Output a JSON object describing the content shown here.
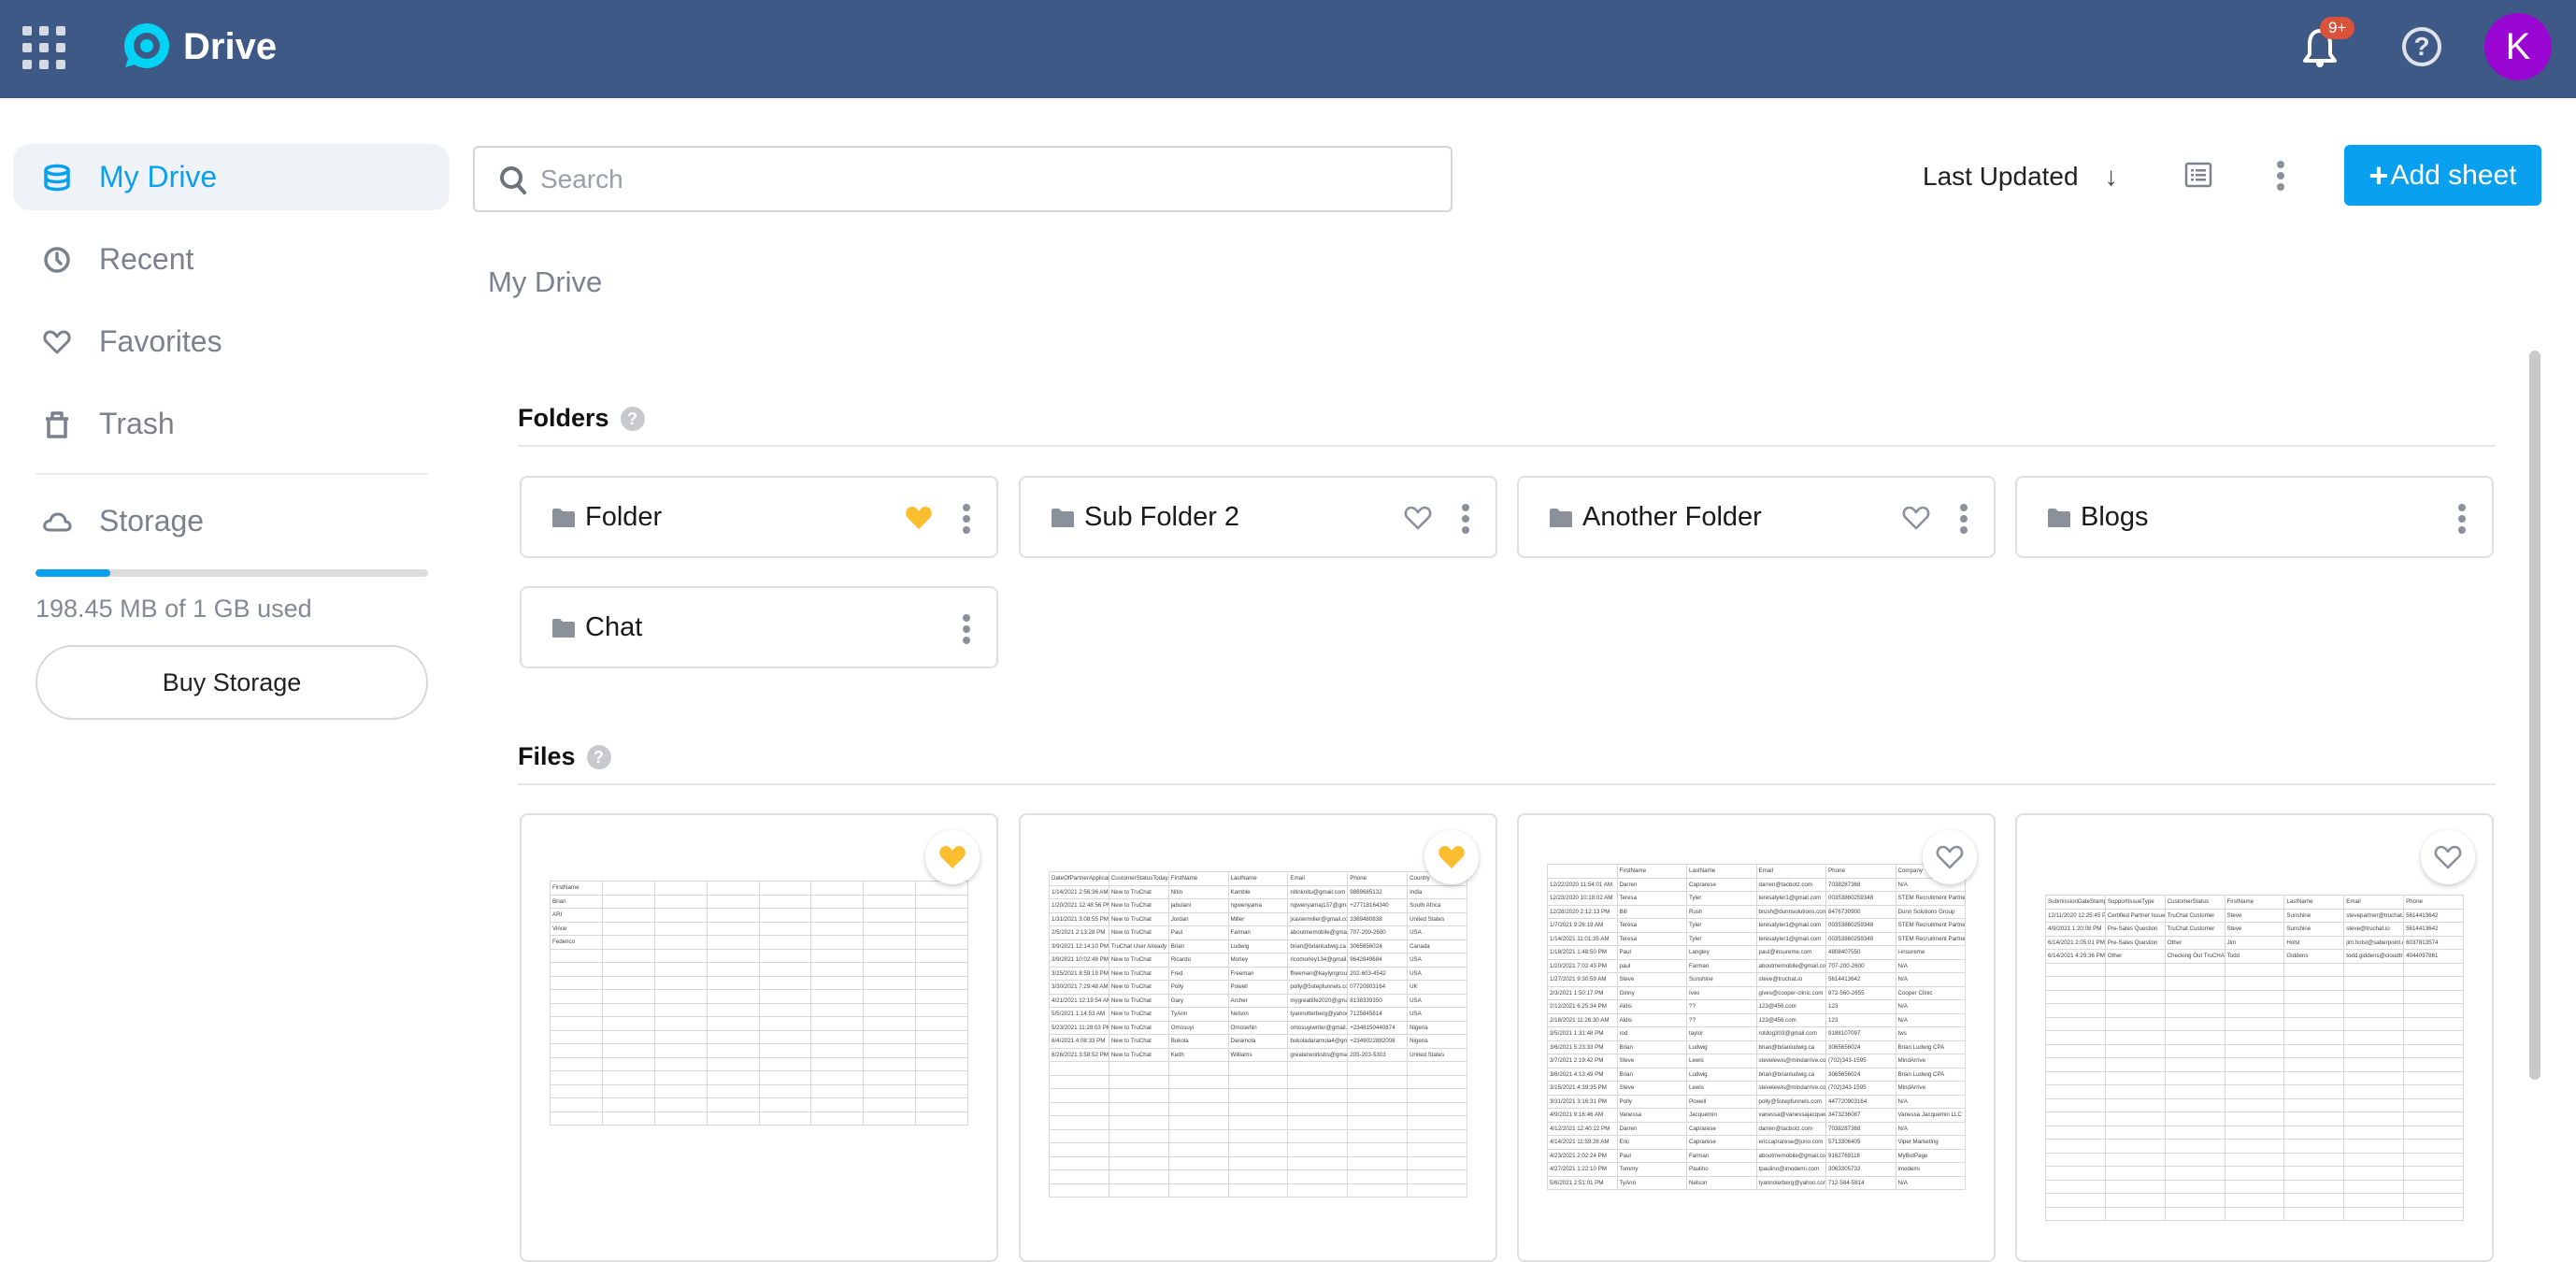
{
  "header": {
    "app_name": "Drive",
    "notification_count": "9+",
    "avatar_initial": "K",
    "colors": {
      "header_bg": "#3f5986",
      "logo": "#00d4f5",
      "badge": "#d9533a",
      "avatar": "#9a06d2"
    }
  },
  "sidebar": {
    "items": [
      {
        "label": "My Drive",
        "icon": "database-icon",
        "active": true
      },
      {
        "label": "Recent",
        "icon": "clock-icon",
        "active": false
      },
      {
        "label": "Favorites",
        "icon": "heart-icon",
        "active": false
      },
      {
        "label": "Trash",
        "icon": "trash-icon",
        "active": false
      }
    ],
    "storage": {
      "label": "Storage",
      "icon": "cloud-icon",
      "used_fraction": 0.19,
      "used_text": "198.45 MB of 1 GB used",
      "buy_label": "Buy Storage"
    },
    "accent": "#0aa0f0"
  },
  "toolbar": {
    "search_placeholder": "Search",
    "search_value": "",
    "sort_label": "Last Updated",
    "sort_direction_icon": "arrow-down-icon",
    "add_label": "Add sheet",
    "add_icon": "+"
  },
  "main": {
    "title": "My Drive",
    "folders_heading": "Folders",
    "files_heading": "Files",
    "help_glyph": "?",
    "folders": [
      {
        "name": "Folder",
        "favorite": true,
        "show_heart": true
      },
      {
        "name": "Sub Folder 2",
        "favorite": false,
        "show_heart": true
      },
      {
        "name": "Another Folder",
        "favorite": false,
        "show_heart": true
      },
      {
        "name": "Blogs",
        "favorite": false,
        "show_heart": false
      },
      {
        "name": "Chat",
        "favorite": false,
        "show_heart": false
      }
    ],
    "files": [
      {
        "favorite": true,
        "preview": {
          "cols": 8,
          "rows": [
            [
              "FirstName"
            ],
            [
              "Brian"
            ],
            [
              "ARI"
            ],
            [
              "Vince"
            ],
            [
              "Federico"
            ]
          ],
          "empty_rows": 13
        }
      },
      {
        "favorite": true,
        "preview": {
          "cols": 7,
          "rows": [
            [
              "DateOfPartnerApplication",
              "CustomerStatusToday",
              "FirstName",
              "LastName",
              "Email",
              "Phone",
              "Country"
            ],
            [
              "1/14/2021 2:56:36 AM",
              "New to TruChat",
              "Nitin",
              "Kamble",
              "nitinknitu@gmail.com",
              "9869685132",
              "India"
            ],
            [
              "1/20/2021 12:48:56 PM",
              "New to TruChat",
              "jabulani",
              "ngwenyama",
              "ngwenyamaj137@gmail.com",
              "+27718164340",
              "South Africa"
            ],
            [
              "1/31/2021 3:08:55 PM",
              "New to TruChat",
              "Jordan",
              "Miller",
              "jxaviermiller@gmail.com",
              "3369480838",
              "United States"
            ],
            [
              "2/5/2021 2:13:28 PM",
              "New to TruChat",
              "Paul",
              "Farman",
              "aboutmemobile@gmail.com",
              "707-200-2600",
              "USA"
            ],
            [
              "3/9/2021 12:14:10 PM",
              "TruChat User Already",
              "Brian",
              "Ludwig",
              "brian@brianludwig.ca",
              "3065656024",
              "Canada"
            ],
            [
              "3/9/2021 10:02:48 PM",
              "New to TruChat",
              "Ricardo",
              "Morley",
              "ricomorley134@gmail.com",
              "9642849684",
              "USA"
            ],
            [
              "3/25/2021 8:59:19 PM",
              "New to TruChat",
              "Fred",
              "Freeman",
              "ffreeman@kaylyngroup.com",
              "202-603-4542",
              "USA"
            ],
            [
              "3/30/2021 7:29:48 AM",
              "New to TruChat",
              "Polly",
              "Powell",
              "polly@5stepfunnels.com",
              "07720903164",
              "UK"
            ],
            [
              "4/21/2021 12:19:54 AM",
              "New to TruChat",
              "Gary",
              "Archer",
              "mygreatlife2020@gmail.com",
              "8138339350",
              "USA"
            ],
            [
              "5/5/2021 1:14:53 AM",
              "New to TruChat",
              "TyAnn",
              "Nelson",
              "tyannotterberg@yahoo.com",
              "7125845814",
              "USA"
            ],
            [
              "5/23/2021 11:28:03 PM",
              "New to TruChat",
              "Omosuyi",
              "Omosehin",
              "omosuyiwriter@gmail.com",
              "+2348150440874",
              "Nigeria"
            ],
            [
              "6/4/2021 4:08:33 PM",
              "New to TruChat",
              "Bukola",
              "Daramola",
              "bukoladaramola4@gmail.com",
              "+2349022882008",
              "Nigeria"
            ],
            [
              "6/26/2021 3:58:52 PM",
              "New to TruChat",
              "Keith",
              "Williams",
              "greaterworksbs@gmail.com",
              "205-203-5303",
              "United States"
            ]
          ],
          "empty_rows": 10
        }
      },
      {
        "favorite": false,
        "preview": {
          "cols": 6,
          "rows": [
            [
              "",
              "FirstName",
              "LastName",
              "Email",
              "Phone",
              "Company"
            ],
            [
              "12/22/2020 11:54:01 AM",
              "Darren",
              "Caprarese",
              "darren@tacbotz.com",
              "7038287368",
              "N/A"
            ],
            [
              "12/23/2020 10:18:02 AM",
              "Teresa",
              "Tyler",
              "teresatyler1@gmail.com",
              "00353860259348",
              "STEM Recruitment Partners"
            ],
            [
              "12/28/2020 2:12:13 PM",
              "Bill",
              "Rush",
              "brush@dunnsolutions.com",
              "8476730900",
              "Dunn Solutions Group"
            ],
            [
              "1/7/2021 9:26:19 AM",
              "Teresa",
              "Tyler",
              "teresatyler1@gmail.com",
              "00353860259348",
              "STEM Recruitment Partners"
            ],
            [
              "1/14/2021 11:01:35 AM",
              "Teresa",
              "Tyler",
              "teresatyler1@gmail.com",
              "00353860259348",
              "STEM Recruitment Partners"
            ],
            [
              "1/18/2021 1:48:50 PM",
              "Paul",
              "Langley",
              "paul@insureme.com",
              "4808407550",
              "i-insureme"
            ],
            [
              "1/20/2021 7:02:43 PM",
              "paul",
              "Farman",
              "aboutmemobile@gmail.com",
              "707-200-2600",
              "N/A"
            ],
            [
              "1/27/2021 9:30:59 AM",
              "Steve",
              "Sunshine",
              "steve@truchat.io",
              "5614413642",
              "N/A"
            ],
            [
              "2/3/2021 1:50:17 PM",
              "Ginny",
              "Ives",
              "gives@cooper-clinic.com",
              "972-560-2655",
              "Cooper Clinic"
            ],
            [
              "2/12/2021 6:25:34 PM",
              "Aldis",
              "??",
              "123@456.com",
              "123",
              "N/A"
            ],
            [
              "2/18/2021 11:26:30 AM",
              "Aldis",
              "??",
              "123@456.com",
              "123",
              "N/A"
            ],
            [
              "3/5/2021 1:31:48 PM",
              "rod",
              "taylor",
              "rotdog303@gmail.com",
              "9188107097",
              "tws"
            ],
            [
              "3/6/2021 5:23:33 PM",
              "Brian",
              "Ludwig",
              "brian@brianludwig.ca",
              "3065656024",
              "Brian Ludwig CPA"
            ],
            [
              "3/7/2021 2:19:42 PM",
              "Steve",
              "Lewis",
              "stevelewis@mindarrive.com",
              "(702)343-1595",
              "MindArrive"
            ],
            [
              "3/8/2021 4:13:49 PM",
              "Brian",
              "Ludwig",
              "brian@brianludwig.ca",
              "3065656024",
              "Brian Ludwig CPA"
            ],
            [
              "3/15/2021 4:39:35 PM",
              "Steve",
              "Lewis",
              "stevelewis@mindarrive.com",
              "(702)343-1595",
              "MindArrive"
            ],
            [
              "3/31/2021 3:16:31 PM",
              "Polly",
              "Powell",
              "polly@5stepfunnels.com",
              "447720903164",
              "N/A"
            ],
            [
              "4/9/2021 9:16:46 AM",
              "Vanessa",
              "Jacquemin",
              "vanessa@vanessajacquemin.com",
              "3473236087",
              "Vanessa Jacquemin LLC"
            ],
            [
              "4/12/2021 12:40:22 PM",
              "Darren",
              "Caprarese",
              "darren@tacbotz.com",
              "7038287368",
              "N/A"
            ],
            [
              "4/14/2021 11:59:26 AM",
              "Eric",
              "Caprarese",
              "ericcaprarese@juno.com",
              "5713306405",
              "Viper Marketing"
            ],
            [
              "4/23/2021 2:02:24 PM",
              "Paul",
              "Farman",
              "aboutmemobile@gmail.com",
              "9162769116",
              "MyBotPage"
            ],
            [
              "4/27/2021 1:22:10 PM",
              "Tommy",
              "Paulino",
              "tpaulino@imodemi.com",
              "3063305733",
              "imodemi"
            ],
            [
              "5/6/2021 2:51:01 PM",
              "TyAnn",
              "Nelson",
              "tyannolerberg@yahoo.com",
              "712-584-5814",
              "N/A"
            ]
          ],
          "empty_rows": 0
        }
      },
      {
        "favorite": false,
        "preview": {
          "cols": 7,
          "rows": [
            [
              "SubmissionDateStamp",
              "SupportIssueType",
              "CustomerStatus",
              "FirstName",
              "LastName",
              "Email",
              "Phone"
            ],
            [
              "12/11/2020 12:25:45 PM",
              "Certified Partner Issue",
              "TruChat Customer",
              "Steve",
              "Sunshine",
              "stevepartner@truchat.io",
              "5614413642"
            ],
            [
              "4/9/2021 1:20:08 PM",
              "Pre-Sales Question",
              "TruChat Customer",
              "Steve",
              "Sunshine",
              "steve@truchat.io",
              "5614413642"
            ],
            [
              "6/14/2021 2:05:01 PM",
              "Pre-Sales Question",
              "Other",
              "Jim",
              "Holst",
              "jim.holst@saberpoint.com",
              "6037813574"
            ],
            [
              "6/14/2021 4:29:36 PM",
              "Other",
              "Checking Out TruCHAT",
              "Todd",
              "Giddens",
              "todd.giddens@cloudtrellz.com",
              "4044097861"
            ]
          ],
          "empty_rows": 19
        }
      }
    ]
  },
  "colors": {
    "favorite": "#fbbe2e",
    "icon_gray": "#8a919b",
    "primary": "#0aa0f0"
  }
}
